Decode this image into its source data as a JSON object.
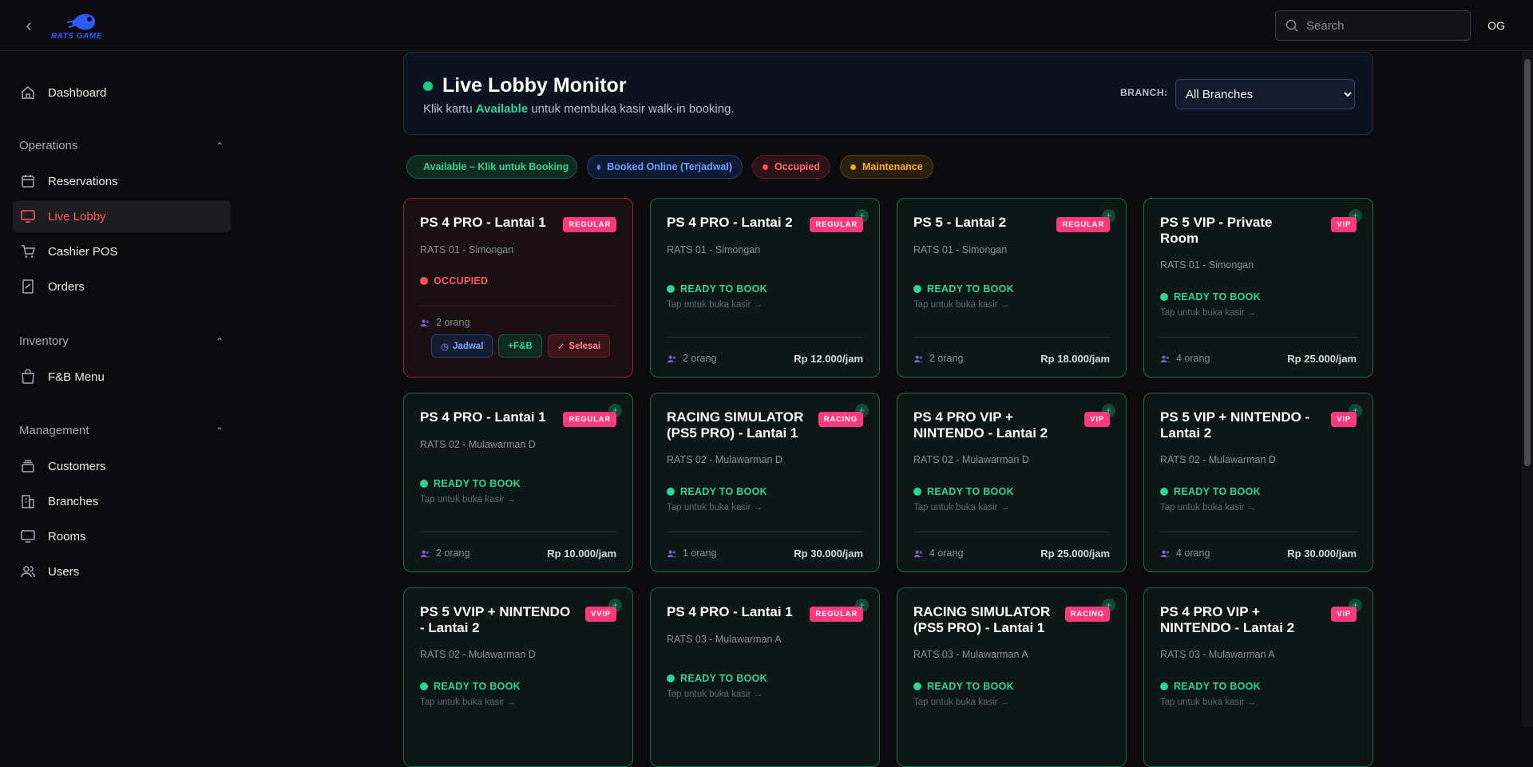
{
  "topbar": {
    "logo_text": "RATS GAME",
    "search_placeholder": "Search",
    "avatar_initials": "OG"
  },
  "sidebar": {
    "dashboard": "Dashboard",
    "sections": {
      "operations": "Operations",
      "inventory": "Inventory",
      "management": "Management"
    },
    "items": {
      "reservations": "Reservations",
      "live_lobby": "Live Lobby",
      "cashier_pos": "Cashier POS",
      "orders": "Orders",
      "fnb_menu": "F&B Menu",
      "customers": "Customers",
      "branches": "Branches",
      "rooms": "Rooms",
      "users": "Users"
    }
  },
  "header": {
    "title": "Live Lobby Monitor",
    "subtitle_pre": "Klik kartu ",
    "subtitle_highlight": "Available",
    "subtitle_post": " untuk membuka kasir walk-in booking.",
    "branch_label": "BRANCH:",
    "branch_selected": "All Branches"
  },
  "legend": {
    "available": "Available – Klik untuk Booking",
    "booked": "Booked Online (Terjadwal)",
    "occupied": "Occupied",
    "maintenance": "Maintenance"
  },
  "rooms": [
    {
      "title": "PS 4 PRO - Lantai 1",
      "badge": "REGULAR",
      "branch": "RATS 01 - Simongan",
      "status": "OCCUPIED",
      "people": "2 orang",
      "actions": {
        "jadwal": "Jadwal",
        "fnb": "+F&B",
        "done": "Selesai"
      }
    },
    {
      "title": "PS 4 PRO - Lantai 2",
      "badge": "REGULAR",
      "branch": "RATS 01 - Simongan",
      "status": "READY TO BOOK",
      "hint": "Tap untuk buka kasir →",
      "people": "2 orang",
      "price": "Rp 12.000/jam"
    },
    {
      "title": "PS 5 - Lantai 2",
      "badge": "REGULAR",
      "branch": "RATS 01 - Simongan",
      "status": "READY TO BOOK",
      "hint": "Tap untuk buka kasir →",
      "people": "2 orang",
      "price": "Rp 18.000/jam"
    },
    {
      "title": "PS 5 VIP - Private Room",
      "badge": "VIP",
      "branch": "RATS 01 - Simongan",
      "status": "READY TO BOOK",
      "hint": "Tap untuk buka kasir →",
      "people": "4 orang",
      "price": "Rp 25.000/jam"
    },
    {
      "title": "PS 4 PRO - Lantai 1",
      "badge": "REGULAR",
      "branch": "RATS 02 - Mulawarman D",
      "status": "READY TO BOOK",
      "hint": "Tap untuk buka kasir →",
      "people": "2 orang",
      "price": "Rp 10.000/jam"
    },
    {
      "title": "RACING SIMULATOR (PS5 PRO) - Lantai 1",
      "badge": "RACING",
      "branch": "RATS 02 - Mulawarman D",
      "status": "READY TO BOOK",
      "hint": "Tap untuk buka kasir →",
      "people": "1 orang",
      "price": "Rp 30.000/jam"
    },
    {
      "title": "PS 4 PRO VIP + NINTENDO - Lantai 2",
      "badge": "VIP",
      "branch": "RATS 02 - Mulawarman D",
      "status": "READY TO BOOK",
      "hint": "Tap untuk buka kasir →",
      "people": "4 orang",
      "price": "Rp 25.000/jam"
    },
    {
      "title": "PS 5 VIP + NINTENDO - Lantai 2",
      "badge": "VIP",
      "branch": "RATS 02 - Mulawarman D",
      "status": "READY TO BOOK",
      "hint": "Tap untuk buka kasir →",
      "people": "4 orang",
      "price": "Rp 30.000/jam"
    },
    {
      "title": "PS 5 VVIP + NINTENDO - Lantai 2",
      "badge": "VVIP",
      "branch": "RATS 02 - Mulawarman D",
      "status": "READY TO BOOK",
      "hint": "Tap untuk buka kasir →"
    },
    {
      "title": "PS 4 PRO - Lantai 1",
      "badge": "REGULAR",
      "branch": "RATS 03 - Mulawarman A",
      "status": "READY TO BOOK",
      "hint": "Tap untuk buka kasir →"
    },
    {
      "title": "RACING SIMULATOR (PS5 PRO) - Lantai 1",
      "badge": "RACING",
      "branch": "RATS 03 - Mulawarman A",
      "status": "READY TO BOOK",
      "hint": "Tap untuk buka kasir →"
    },
    {
      "title": "PS 4 PRO VIP + NINTENDO - Lantai 2",
      "badge": "VIP",
      "branch": "RATS 03 - Mulawarman A",
      "status": "READY TO BOOK",
      "hint": "Tap untuk buka kasir →"
    }
  ]
}
